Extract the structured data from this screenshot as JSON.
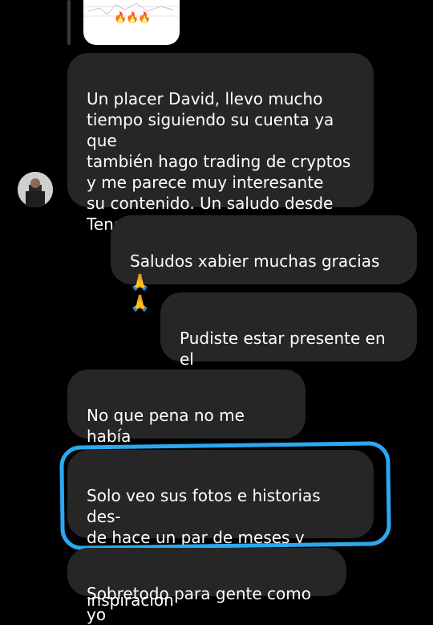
{
  "shared_post": {
    "emoji": "🔥🔥🔥"
  },
  "messages": [
    {
      "id": "m1",
      "side": "received",
      "text": "Un placer David, llevo mucho\ntiempo siguiendo su cuenta ya que\ntambién hago trading de cryptos\ny me parece muy interesante\nsu contenido. Un saludo desde\nTenerife, España"
    },
    {
      "id": "m2",
      "side": "sent",
      "text": "Saludos xabier muchas gracias 🙏\n🙏"
    },
    {
      "id": "m3",
      "side": "sent",
      "text": "Pudiste estar presente en el\nzoom?"
    },
    {
      "id": "m4",
      "side": "received",
      "text": "No que pena no me había\nenterado del zoom"
    },
    {
      "id": "m5",
      "side": "received",
      "text": "Solo veo sus fotos e historias des-\nde hace un par de meses y quería\ndecirle que es una gran inspiración"
    },
    {
      "id": "m6",
      "side": "received",
      "text": "Sobretodo para gente como yo"
    }
  ],
  "colors": {
    "bubble": "#262626",
    "background": "#000000",
    "highlight": "#2ba8f0"
  }
}
